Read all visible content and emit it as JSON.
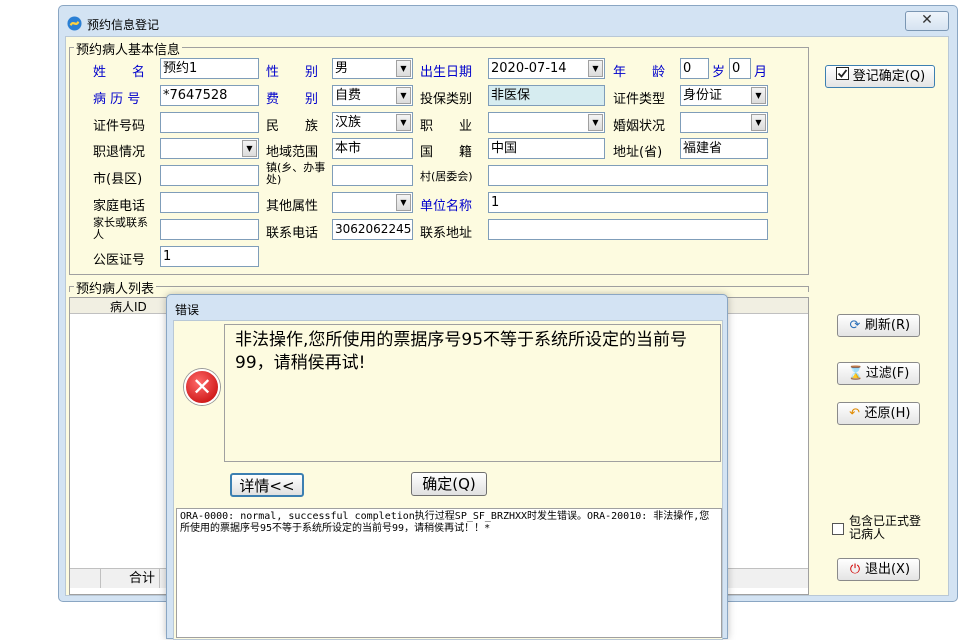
{
  "window": {
    "title": "预约信息登记",
    "close": "✕"
  },
  "basic": {
    "group_title": "预约病人基本信息",
    "name_label": "姓　　名",
    "name_value": "预约1",
    "sex_label": "性　　别",
    "sex_value": "男",
    "birth_label": "出生日期",
    "birth_value": "2020-07-14",
    "age_label": "年　　龄",
    "age_value": "0",
    "age_unit_year": "岁",
    "age_month": "0",
    "age_unit_month": "月",
    "record_label": "病 历 号",
    "record_value": "*7647528",
    "fee_label": "费　　别",
    "fee_value": "自费",
    "ins_label": "投保类别",
    "ins_value": "非医保",
    "idtype_label": "证件类型",
    "idtype_value": "身份证",
    "idno_label": "证件号码",
    "idno_value": "",
    "nation_label": "民　　族",
    "nation_value": "汉族",
    "job_label": "职　　业",
    "job_value": "",
    "marry_label": "婚姻状况",
    "marry_value": "",
    "retire_label": "职退情况",
    "retire_value": "",
    "region_label": "地域范围",
    "region_value": "本市",
    "country_label": "国　　籍",
    "country_value": "中国",
    "province_label": "地址(省)",
    "province_value": "福建省",
    "city_label": "市(县区)",
    "city_value": "",
    "town_label": "镇(乡、办事处)",
    "town_value": "",
    "village_label": "村(居委会)",
    "village_value": "",
    "homephone_label": "家庭电话",
    "homephone_value": "",
    "other_label": "其他属性",
    "other_value": "",
    "unit_label": "单位名称",
    "unit_value": "1",
    "guardian_label": "家长或联系人",
    "guardian_value": "",
    "contactphone_label": "联系电话",
    "contactphone_value": "3062062245",
    "contactaddr_label": "联系地址",
    "contactaddr_value": "",
    "medcard_label": "公医证号",
    "medcard_value": "1"
  },
  "list": {
    "group_title": "预约病人列表",
    "col_patient_id": "病人ID",
    "total_label": "合计"
  },
  "side": {
    "confirm": "登记确定(Q)",
    "refresh": "刷新(R)",
    "filter": "过滤(F)",
    "restore": "还原(H)",
    "include_label": "包含已正式登记病人",
    "exit": "退出(X)"
  },
  "dialog": {
    "title": "错误",
    "message": "非法操作,您所使用的票据序号95不等于系统所设定的当前号99，请稍侯再试!",
    "details_button": "详情<<",
    "ok_button": "确定(Q)",
    "detail_text": "ORA-0000: normal, successful completion执行过程SP_SF_BRZHXX时发生错误。ORA-20010: 非法操作,您所使用的票据序号95不等于系统所设定的当前号99，请稍侯再试！！*"
  },
  "colors": {
    "accent_blue": "#0000cc",
    "form_bg": "#fdfbe0",
    "frame_bg": "#d3e3f3"
  }
}
